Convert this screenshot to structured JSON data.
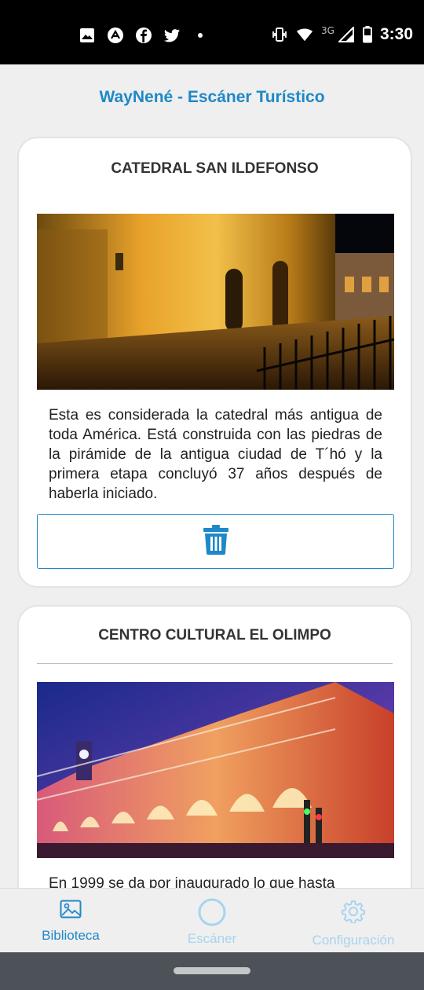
{
  "status_bar": {
    "time": "3:30",
    "network": "3G",
    "left_icons": [
      "image-icon",
      "app-icon",
      "facebook-icon",
      "twitter-icon",
      "dot-icon"
    ],
    "right_icons": [
      "vibrate-icon",
      "wifi-icon",
      "signal-icon",
      "battery-icon"
    ]
  },
  "app": {
    "title": "WayNené - Escáner Turístico"
  },
  "places": [
    {
      "title": "CATEDRAL SAN ILDEFONSO",
      "description": "Esta es considerada la catedral más antigua de toda América. Está construida con las piedras de la pirámide de la antigua ciudad de T´hó y la primera etapa concluyó 37 años después de haberla iniciado.",
      "action_icon": "trash-icon"
    },
    {
      "title": "CENTRO CULTURAL EL OLIMPO",
      "description": "En 1999 se da por inaugurado lo que hasta"
    }
  ],
  "bottom_nav": [
    {
      "label": "Biblioteca",
      "icon": "gallery-icon",
      "active": true
    },
    {
      "label": "Escáner",
      "icon": "circle-icon",
      "active": false
    },
    {
      "label": "Configuración",
      "icon": "gear-icon",
      "active": false
    }
  ],
  "colors": {
    "accent": "#1e88c8",
    "accent_light": "#a8d4ee",
    "background": "#efefef"
  }
}
